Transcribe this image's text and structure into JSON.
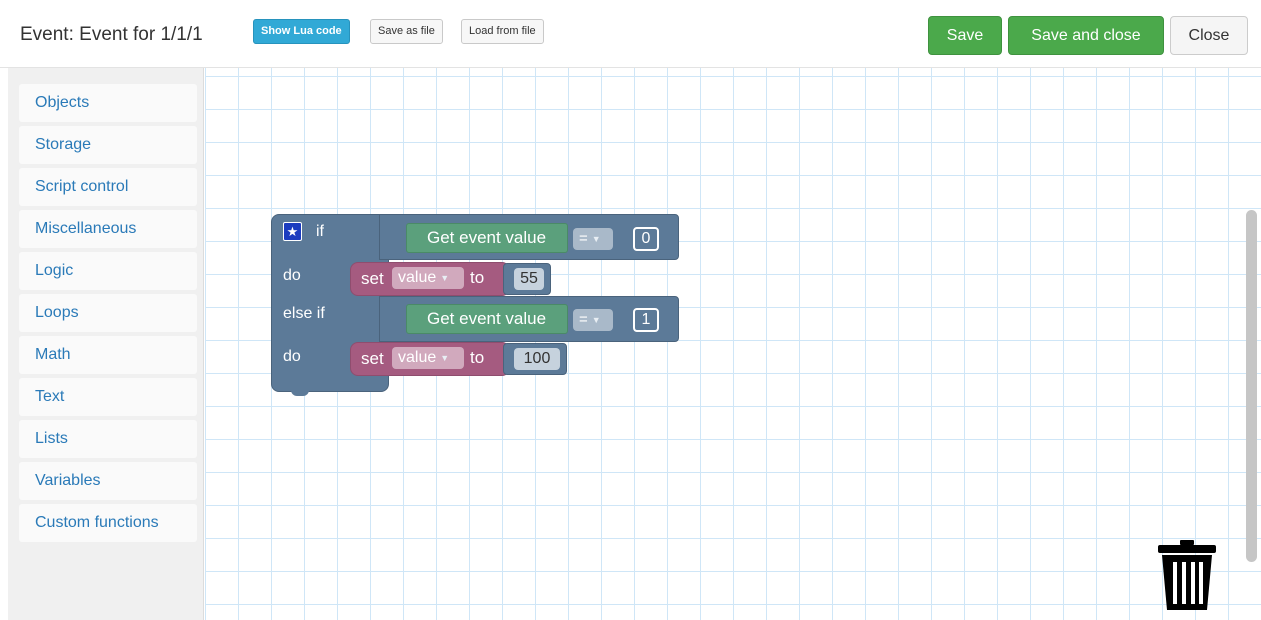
{
  "header": {
    "title": "Event: Event for 1/1/1",
    "show_lua_label": "Show Lua code",
    "save_as_file_label": "Save as file",
    "load_from_file_label": "Load from file",
    "save_label": "Save",
    "save_close_label": "Save and close",
    "close_label": "Close"
  },
  "sidebar": {
    "categories": [
      "Objects",
      "Storage",
      "Script control",
      "Miscellaneous",
      "Logic",
      "Loops",
      "Math",
      "Text",
      "Lists",
      "Variables",
      "Custom functions"
    ]
  },
  "blocks": {
    "if_label": "if",
    "do_label_1": "do",
    "elseif_label": "else if",
    "do_label_2": "do",
    "event_value_1": "Get event value",
    "event_value_2": "Get event value",
    "op_1": "=",
    "op_2": "=",
    "compare_1": "0",
    "compare_2": "1",
    "set_1": "set",
    "set_2": "set",
    "var_1": "value",
    "var_2": "value",
    "to_1": "to",
    "to_2": "to",
    "assign_1": "55",
    "assign_2": "100"
  },
  "colors": {
    "accent_info": "#31a9d6",
    "accent_success": "#4ba94b",
    "logic_block": "#5c7a98",
    "event_block": "#5ba07c",
    "variable_block": "#a55b80",
    "link": "#2a7ab8"
  },
  "icons": {
    "star": "star-icon",
    "trash": "trash-icon",
    "caret": "caret-down-icon"
  }
}
